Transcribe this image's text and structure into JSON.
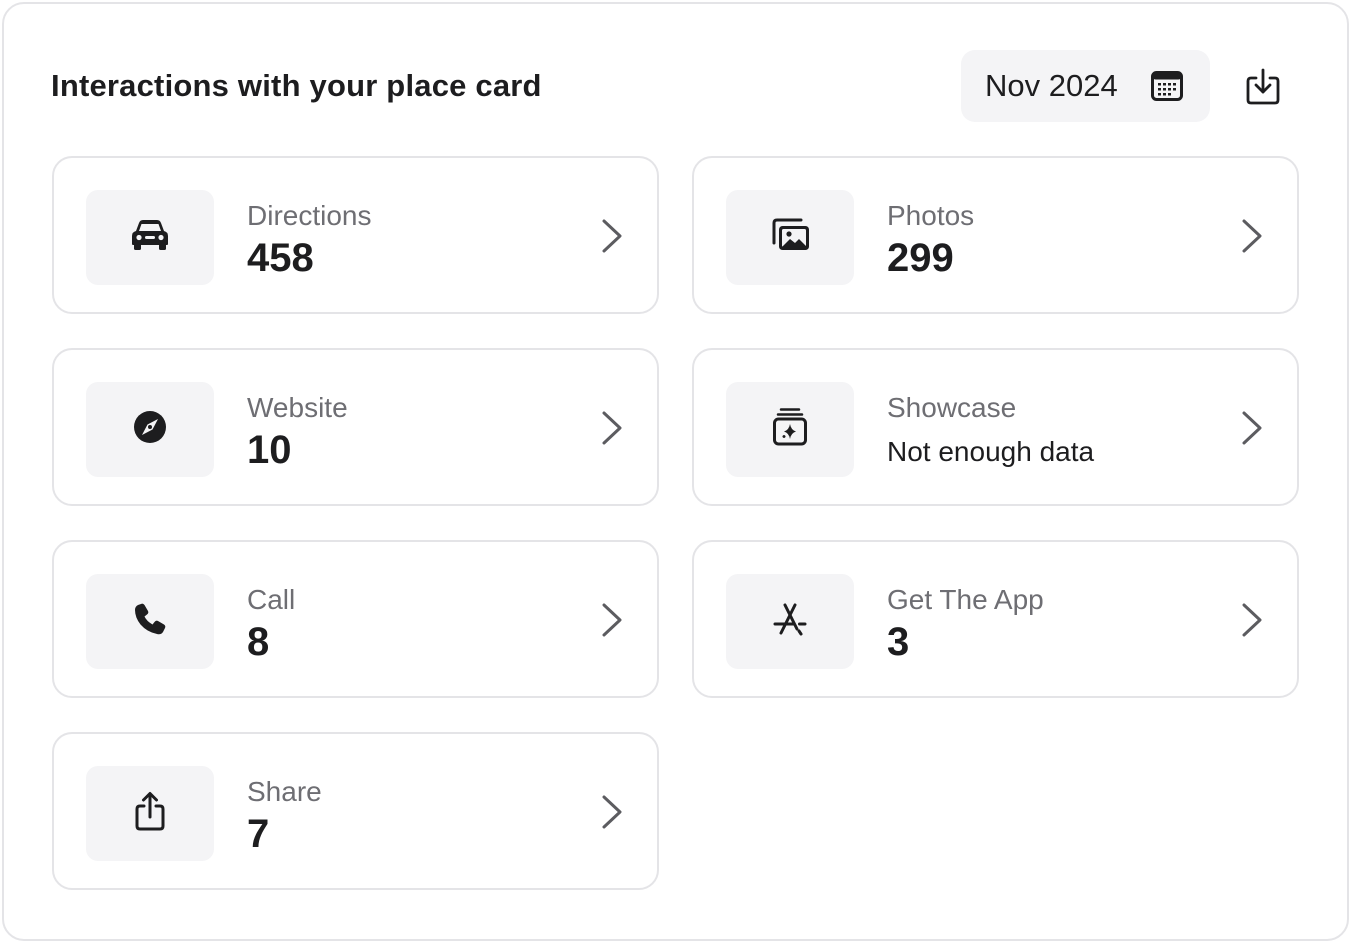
{
  "header": {
    "title": "Interactions with your place card",
    "date_label": "Nov 2024"
  },
  "cards": [
    {
      "label": "Directions",
      "value": "458",
      "icon": "car-icon"
    },
    {
      "label": "Photos",
      "value": "299",
      "icon": "photos-icon"
    },
    {
      "label": "Website",
      "value": "10",
      "icon": "compass-icon"
    },
    {
      "label": "Showcase",
      "value": "Not enough data",
      "icon": "showcase-icon"
    },
    {
      "label": "Call",
      "value": "8",
      "icon": "phone-icon"
    },
    {
      "label": "Get The App",
      "value": "3",
      "icon": "app-store-icon"
    },
    {
      "label": "Share",
      "value": "7",
      "icon": "share-icon"
    }
  ]
}
